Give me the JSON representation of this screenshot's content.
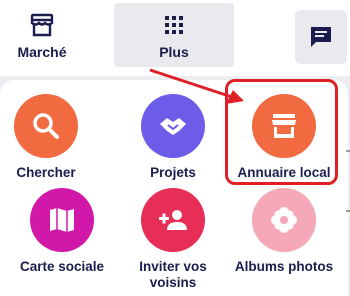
{
  "topbar": {
    "marche_label": "Marché",
    "plus_label": "Plus"
  },
  "menu": {
    "items": [
      {
        "label": "Chercher",
        "icon": "search-icon",
        "color": "#f26a3f"
      },
      {
        "label": "Projets",
        "icon": "handshake-icon",
        "color": "#6c5ce7"
      },
      {
        "label": "Annuaire local",
        "icon": "storefront-icon",
        "color": "#f26a3f"
      },
      {
        "label": "Carte sociale",
        "icon": "map-icon",
        "color": "#d118a8"
      },
      {
        "label": "Inviter vos voisins",
        "icon": "person-add-icon",
        "color": "#e62e56"
      },
      {
        "label": "Albums photos",
        "icon": "flower-icon",
        "color": "#f4a8b8"
      }
    ]
  },
  "annotation": {
    "highlight_color": "#e01f26"
  }
}
